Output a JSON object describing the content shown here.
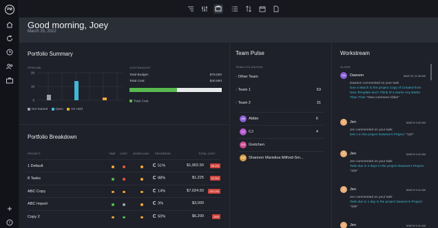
{
  "rail": {
    "logo": "PM",
    "items": [
      "home-icon",
      "refresh-icon",
      "clock-icon",
      "people-icon",
      "briefcase-icon",
      "plus-icon",
      "help-icon"
    ]
  },
  "toolbar": {
    "items": [
      "broadcast-icon",
      "sliders-icon",
      "dashboard-icon",
      "list-icon",
      "sort-icon",
      "calendar-icon",
      "document-icon"
    ],
    "active": "dashboard-icon"
  },
  "greeting": {
    "title": "Good morning, Joey",
    "date": "March 25, 2022"
  },
  "portfolio_summary": {
    "title": "Portfolio Summary",
    "pipeline_label": "PIPELINE",
    "cost_label": "COST/BUDGET",
    "total_budget_label": "Total Budget:",
    "total_budget_value": "$79,000",
    "total_cost_label": "Total Cost:",
    "total_cost_value": "$40,693",
    "cost_fraction": 0.515,
    "total_cost_legend": "Total Cost",
    "legend": [
      "Not Started",
      "Open",
      "On Hold"
    ]
  },
  "chart_data": {
    "type": "bar",
    "categories": [
      "Not Started",
      "Open",
      "On Hold"
    ],
    "values": [
      4,
      14,
      2
    ],
    "yticks": [
      "0",
      "10",
      "20"
    ],
    "ylim": [
      0,
      20
    ],
    "grid": true,
    "colors": [
      "#9aa0ac",
      "#41b6d4",
      "#f0a53a"
    ]
  },
  "breakdown": {
    "title": "Portfolio Breakdown",
    "headers": [
      "PROJECT",
      "TIME",
      "COST",
      "WORKLOAD",
      "PROGRESS",
      "TOTAL COST"
    ],
    "rows": [
      {
        "name": "1 Default",
        "dots": [
          "#f0a53a",
          "#e2553f",
          "#f0a53a"
        ],
        "progress": "51%",
        "cost": "$1,902.50",
        "badge": "95.1%"
      },
      {
        "name": "8 Tasks",
        "dots": [
          "#58b94f",
          "#e2553f",
          "#f0a53a"
        ],
        "progress": "88%",
        "cost": "$1,225",
        "badge": "22.5%"
      },
      {
        "name": "ABC Copy",
        "dots": [
          "#f0a53a",
          "#f0a53a",
          "#f0a53a"
        ],
        "progress": "14%",
        "cost": "$7,024.50",
        "badge": "251.2%"
      },
      {
        "name": "ABC Import",
        "dots": [
          "#58b94f",
          "#9aa0ac",
          "#f0a53a"
        ],
        "progress": "3%",
        "cost": "$3,000",
        "badge": ""
      },
      {
        "name": "Copy 2",
        "dots": [
          "#f0a53a",
          "#58b94f",
          "#f0a53a"
        ],
        "progress": "50%",
        "cost": "$6,200",
        "badge": "24%"
      }
    ]
  },
  "team_pulse": {
    "title": "Team Pulse",
    "sublabel": "TEAM UTILIZATION",
    "groups": [
      {
        "label": "Other Team",
        "count": ""
      },
      {
        "label": "Team 1",
        "count": "63"
      },
      {
        "label": "Team 2",
        "count": "31"
      }
    ],
    "members": [
      {
        "initials": "AB",
        "name": "Abbie",
        "count": "6",
        "color": "#8b5fd6"
      },
      {
        "initials": "CJ",
        "name": "CJ",
        "count": "4",
        "color": "#b65ad1"
      },
      {
        "initials": "GR",
        "name": "Gretchen",
        "count": "",
        "color": "#c94f93"
      },
      {
        "initials": "SM",
        "name": "Shannon Marielisa Milford-Sm...",
        "count": "",
        "color": "#d9a04a"
      }
    ]
  },
  "workstream": {
    "title": "Workstream",
    "sublabel": "OLDER",
    "items": [
      {
        "initials": "DA",
        "who": "Dawson",
        "when": "MAR 22 11:38 AM",
        "color": "#8b5fd6",
        "pre": "Dawson commented on your task",
        "link": "Due 4 March in the project Copy of Created from New Template and I Think of a Name Any Better Than That",
        "post": ": \"New comment Abbie\""
      },
      {
        "initials": "J",
        "who": "Jen",
        "when": "MAR 8 9:42 AM",
        "color": "#e9b07a",
        "pre": "Jen commented on your task",
        "link": "test 1 in the project Dawson's Project",
        "post": ": \"110\""
      },
      {
        "initials": "J",
        "who": "Jen",
        "when": "MAR 8 9:42 AM",
        "color": "#e9b07a",
        "pre": "Jen commented on your task",
        "link": "Task due in 2 days in the project Dawson's Project",
        "post": ": \"109\""
      },
      {
        "initials": "J",
        "who": "Jen",
        "when": "MAR 8 9:41 AM",
        "color": "#e9b07a",
        "pre": "Jen commented on your task",
        "link": "Task due in 1 day in the project Dawson's Project",
        "post": ": \"108\""
      },
      {
        "initials": "J",
        "who": "Jen",
        "when": "MAR 8 9:41 AM",
        "color": "#e9b07a",
        "pre": "",
        "link": "",
        "post": ""
      }
    ]
  }
}
